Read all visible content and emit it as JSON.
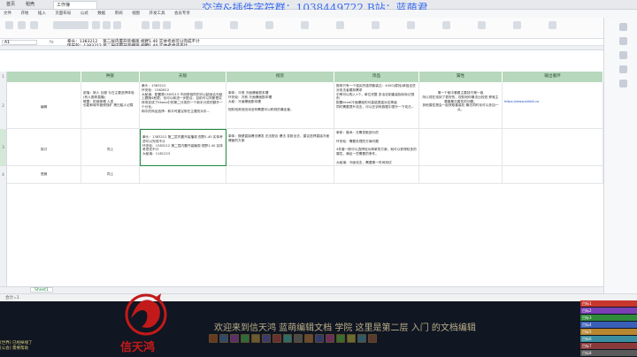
{
  "banner": "交流&插件字符群：1038449722 B站：蓝萌君",
  "tabs": [
    "首页",
    "稻壳",
    "工作簿"
  ],
  "menu": [
    "文件",
    "开始",
    "插入",
    "页面布局",
    "公式",
    "数据",
    "审阅",
    "视图",
    "开发工具",
    "会员专享"
  ],
  "namebox": "A1",
  "formula": "拳头：1383212    第二层内置开装播观 视野1.40 实体考虑可以完成不计\n环安轮：1383212 第二层内置开装播观 视野1.40 实体考虑还不计\n大秘境：1181223",
  "header_row": [
    "种族",
    "天赋",
    "橙装",
    "饰品",
    "属性",
    "输出循环"
  ],
  "rows": [
    {
      "num": "2",
      "label": "编辑",
      "c1": "部落：狼人 巨魔 亏白主要选择体验 (有人推荐直播)\n联盟：机械侏儒 人类\n也能和城市被侵蚀矿 黑白骷人记载",
      "c2": "拳头：1383212\n环安轮：1382812\n大秘境：配置是1383213 不用带相同的可以超适合天赋上跟随4就更，也可以和进一步配合，目前可以判断是实体场变成了Kkass中的第二分类的一个新手分类的额外一个分化。\n和平的饰品选择：和平时建议带在主要的对手...",
      "c3": "单体：冷煞 冷面爆面剧本槽\n环安轮：冷煞 冷面爆面剧本槽\n大秘：冷面爆面剧本槽\n\n现阶段其他流派没有需要可以和别的暴走套。",
      "c4": "推荐只有一个强买的强项套装达：4000(腐蚀)单独这些\n对攻击者模拟需求\n中等可以购入1个，单位完整 多活化制重量指标标记规则\n配置ilevel冷面爆面的可高能提高对应等级\n同时需要提升攻击，可以在训练数据中提升一下攻击...",
      "c5": "第一个秘中看看主要技巧第一组\n所以现在找到了更好的，现阶段你暴击比较低 那就主要看暴击属性的问题。\n其他属性是会一起获取套装化 暴击同时化可以多加一点。",
      "c6": "https://www.bilibili.co"
    },
    {
      "num": "3",
      "label": "探讨",
      "c1": "同上",
      "c2": "拳头：1383212    第二层内置开装播观 视野1.40 实体考虑可以完成不计\n环安轮：1383212 第二层内置开装播观 视野1.40 实体考虑还不计\n大秘境：1181223",
      "c3": "单体：随便直接爆击爆发 无法配合 爆击 发射出去，建议选择直接冷面爆面的方案",
      "c4": "单体：魔术：无需发散部分的\n\n环安轮：需要处理的方案问题\n\n4件套一般可以选择较为简单的方案，就可以获得较多的属性，满足一些需要的条件。\n\n大秘境：冷面攻击，需要第一时间测试",
      "c5": "",
      "c6": ""
    },
    {
      "num": "4",
      "label": "恶魔",
      "c1": "同上",
      "c2": "",
      "c3": "",
      "c4": "",
      "c5": "",
      "c6": ""
    }
  ],
  "sheet_tab": "Sheet1",
  "status": "合计=1",
  "logo_text": "信天鸿",
  "overlay_text": "欢迎来到信天鸿 蓝萌编辑文档 学院 这里是第二层 入门 的文档编辑",
  "chat": [
    "[世界] 已经掉线了",
    "[公会] 需要帮助"
  ],
  "raid": [
    {
      "name": "目标1",
      "color": "#c8372d"
    },
    {
      "name": "目标2",
      "color": "#7a3fb5"
    },
    {
      "name": "目标3",
      "color": "#2f8a3a"
    },
    {
      "name": "目标4",
      "color": "#3a5fb8"
    },
    {
      "name": "目标5",
      "color": "#b8862f"
    },
    {
      "name": "目标6",
      "color": "#3b8ea0"
    },
    {
      "name": "目标7",
      "color": "#8a3a3a"
    },
    {
      "name": "目标8",
      "color": "#5a5a5a"
    }
  ]
}
